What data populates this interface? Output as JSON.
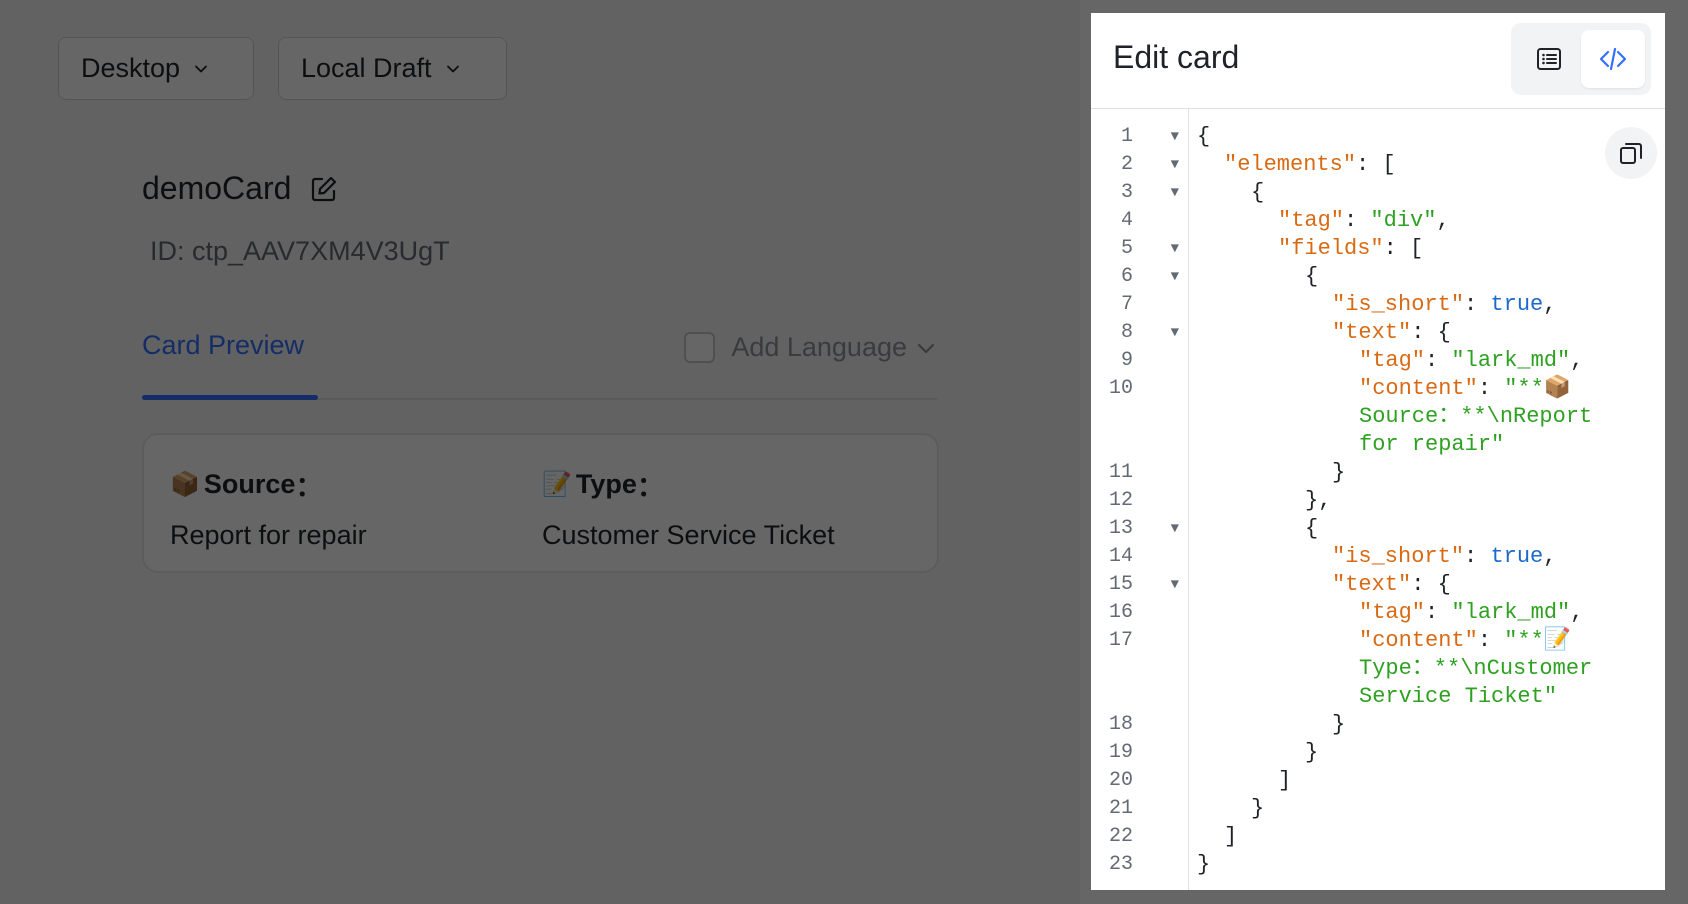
{
  "toolbar": {
    "device_label": "Desktop",
    "draft_label": "Local Draft"
  },
  "card": {
    "name": "demoCard",
    "id_text": "ID: ctp_AAV7XM4V3UgT"
  },
  "tabs": {
    "preview_label": "Card Preview",
    "add_language_label": "Add Language"
  },
  "preview": {
    "fields": [
      {
        "emoji": "📦",
        "label": "Source",
        "colon": "：",
        "value": "Report for repair"
      },
      {
        "emoji": "📝",
        "label": "Type",
        "colon": "：",
        "value": "Customer Service Ticket"
      }
    ]
  },
  "editor": {
    "title": "Edit card",
    "code_lines": [
      {
        "n": "1",
        "fold": true,
        "indent": 0,
        "parts": [
          [
            "p",
            "{"
          ]
        ]
      },
      {
        "n": "2",
        "fold": true,
        "indent": 1,
        "parts": [
          [
            "k",
            "\"elements\""
          ],
          [
            "p",
            ": ["
          ]
        ]
      },
      {
        "n": "3",
        "fold": true,
        "indent": 2,
        "parts": [
          [
            "p",
            "{"
          ]
        ]
      },
      {
        "n": "4",
        "fold": false,
        "indent": 3,
        "parts": [
          [
            "k",
            "\"tag\""
          ],
          [
            "p",
            ": "
          ],
          [
            "s",
            "\"div\""
          ],
          [
            "p",
            ","
          ]
        ]
      },
      {
        "n": "5",
        "fold": true,
        "indent": 3,
        "parts": [
          [
            "k",
            "\"fields\""
          ],
          [
            "p",
            ": ["
          ]
        ]
      },
      {
        "n": "6",
        "fold": true,
        "indent": 4,
        "parts": [
          [
            "p",
            "{"
          ]
        ]
      },
      {
        "n": "7",
        "fold": false,
        "indent": 5,
        "parts": [
          [
            "k",
            "\"is_short\""
          ],
          [
            "p",
            ": "
          ],
          [
            "b",
            "true"
          ],
          [
            "p",
            ","
          ]
        ]
      },
      {
        "n": "8",
        "fold": true,
        "indent": 5,
        "parts": [
          [
            "k",
            "\"text\""
          ],
          [
            "p",
            ": {"
          ]
        ]
      },
      {
        "n": "9",
        "fold": false,
        "indent": 6,
        "parts": [
          [
            "k",
            "\"tag\""
          ],
          [
            "p",
            ": "
          ],
          [
            "s",
            "\"lark_md\""
          ],
          [
            "p",
            ","
          ]
        ]
      },
      {
        "n": "10",
        "fold": false,
        "indent": 6,
        "parts": [
          [
            "k",
            "\"content\""
          ],
          [
            "p",
            ": "
          ],
          [
            "s",
            "\"**📦Source：**\\nReport for repair\""
          ]
        ]
      },
      {
        "n": "11",
        "fold": false,
        "indent": 5,
        "parts": [
          [
            "p",
            "}"
          ]
        ]
      },
      {
        "n": "12",
        "fold": false,
        "indent": 4,
        "parts": [
          [
            "p",
            "},"
          ]
        ]
      },
      {
        "n": "13",
        "fold": true,
        "indent": 4,
        "parts": [
          [
            "p",
            "{"
          ]
        ]
      },
      {
        "n": "14",
        "fold": false,
        "indent": 5,
        "parts": [
          [
            "k",
            "\"is_short\""
          ],
          [
            "p",
            ": "
          ],
          [
            "b",
            "true"
          ],
          [
            "p",
            ","
          ]
        ]
      },
      {
        "n": "15",
        "fold": true,
        "indent": 5,
        "parts": [
          [
            "k",
            "\"text\""
          ],
          [
            "p",
            ": {"
          ]
        ]
      },
      {
        "n": "16",
        "fold": false,
        "indent": 6,
        "parts": [
          [
            "k",
            "\"tag\""
          ],
          [
            "p",
            ": "
          ],
          [
            "s",
            "\"lark_md\""
          ],
          [
            "p",
            ","
          ]
        ]
      },
      {
        "n": "17",
        "fold": false,
        "indent": 6,
        "parts": [
          [
            "k",
            "\"content\""
          ],
          [
            "p",
            ": "
          ],
          [
            "s",
            "\"**📝Type：**\\nCustomer Service Ticket\""
          ]
        ]
      },
      {
        "n": "18",
        "fold": false,
        "indent": 5,
        "parts": [
          [
            "p",
            "}"
          ]
        ]
      },
      {
        "n": "19",
        "fold": false,
        "indent": 4,
        "parts": [
          [
            "p",
            "}"
          ]
        ]
      },
      {
        "n": "20",
        "fold": false,
        "indent": 3,
        "parts": [
          [
            "p",
            "]"
          ]
        ]
      },
      {
        "n": "21",
        "fold": false,
        "indent": 2,
        "parts": [
          [
            "p",
            "}"
          ]
        ]
      },
      {
        "n": "22",
        "fold": false,
        "indent": 1,
        "parts": [
          [
            "p",
            "]"
          ]
        ]
      },
      {
        "n": "23",
        "fold": false,
        "indent": 0,
        "parts": [
          [
            "p",
            "}"
          ]
        ]
      }
    ]
  },
  "colors": {
    "accent": "#3370ff",
    "json_key": "#d96a14",
    "json_string": "#2ea121",
    "json_bool": "#1b6ac9"
  },
  "icons": {
    "dropdown": "chevron-down-icon",
    "edit_name": "edit-icon",
    "form_view": "form-view-icon",
    "code_view": "code-view-icon",
    "copy": "copy-icon"
  }
}
